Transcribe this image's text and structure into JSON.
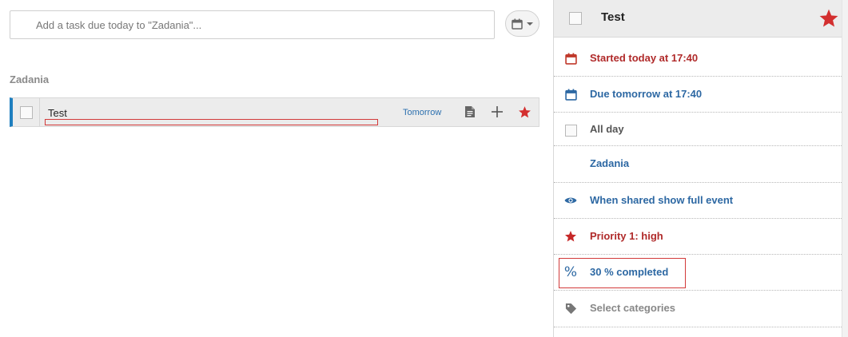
{
  "add_task": {
    "placeholder": "Add a task due today to \"Zadania\"..."
  },
  "date_picker": {
    "icon": "calendar-icon"
  },
  "list": {
    "name": "Zadania",
    "tasks": [
      {
        "title": "Test",
        "due": "Tomorrow",
        "completed": false,
        "starred": true
      }
    ]
  },
  "details": {
    "title": "Test",
    "starred": true,
    "start": "Started today at 17:40",
    "due": "Due tomorrow at 17:40",
    "all_day": "All day",
    "list": "Zadania",
    "sharing": "When shared show full event",
    "priority": "Priority 1: high",
    "progress": "30 % completed",
    "progress_value": 30,
    "categories": "Select categories"
  },
  "colors": {
    "accent_blue": "#2d68a3",
    "accent_red": "#b02a2a",
    "star_red": "#d32f2f",
    "row_marker": "#1f7fbf"
  }
}
